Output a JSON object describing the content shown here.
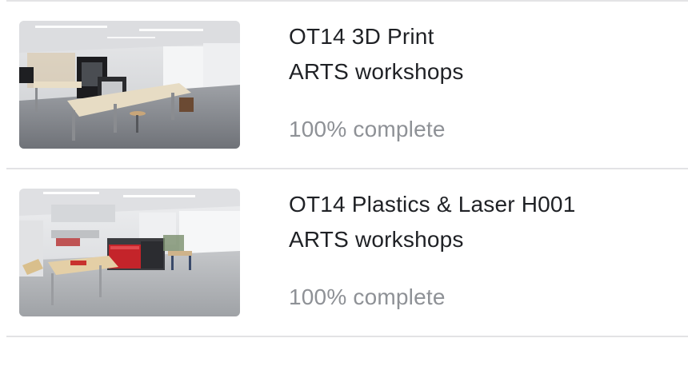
{
  "items": [
    {
      "title": "OT14 3D Print",
      "subtitle": "ARTS workshops",
      "progress_text": "100% complete",
      "progress": 1.0,
      "thumbnail": "workshop-3d-print-photo"
    },
    {
      "title": "OT14 Plastics & Laser H001",
      "subtitle": "ARTS workshops",
      "progress_text": "100% complete",
      "progress": 1.0,
      "thumbnail": "workshop-plastics-laser-photo"
    }
  ]
}
